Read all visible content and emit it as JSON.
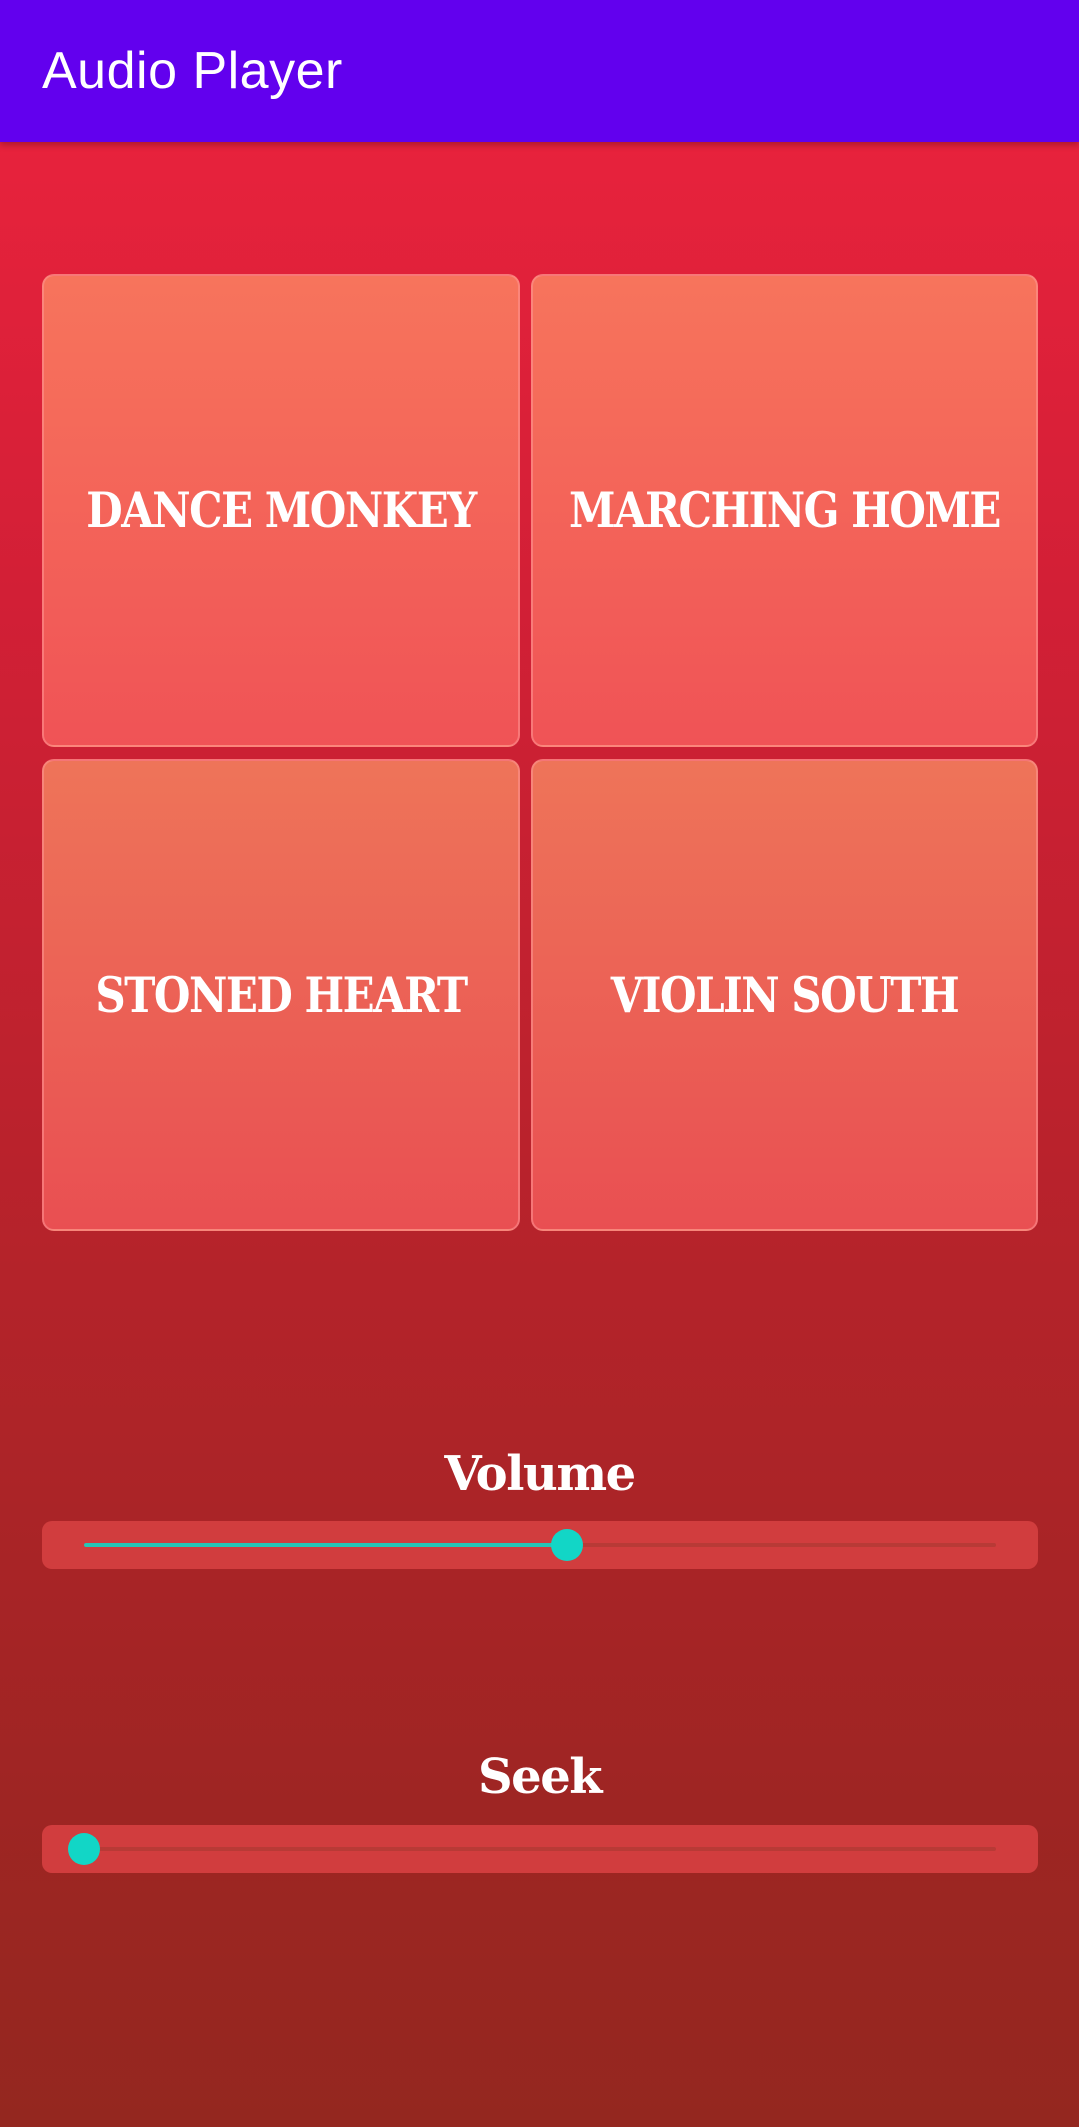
{
  "app_bar": {
    "title": "Audio Player",
    "color": "#6200ee"
  },
  "tracks": [
    {
      "label": "DANCE MONKEY"
    },
    {
      "label": "MARCHING HOME"
    },
    {
      "label": "STONED HEART"
    },
    {
      "label": "VIOLIN SOUTH"
    }
  ],
  "volume": {
    "label": "Volume",
    "value_fraction": 0.53
  },
  "seek": {
    "label": "Seek",
    "value_fraction": 0.0
  },
  "colors": {
    "slider_accent": "#12d6c6",
    "background_top": "#ee233e",
    "background_bottom": "#94271f"
  }
}
